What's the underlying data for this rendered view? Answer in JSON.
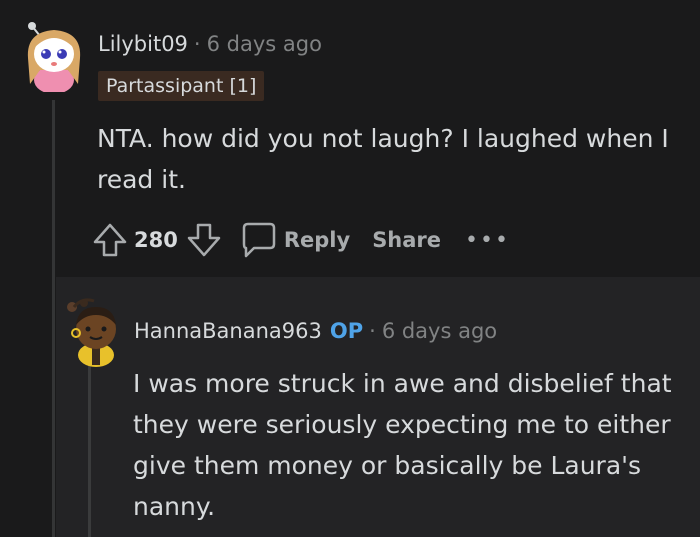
{
  "comment": {
    "username": "Lilybit09",
    "separator": "·",
    "time": "6 days ago",
    "flair": "Partassipant [1]",
    "body": "NTA. how did you not laugh? I laughed when I read it.",
    "score": "280",
    "reply_label": "Reply",
    "share_label": "Share",
    "more_label": "•••"
  },
  "reply": {
    "username": "HannaBanana963",
    "op_badge": "OP",
    "separator": "·",
    "time": "6 days ago",
    "body": "I was more struck in awe and disbelief that they were seriously expecting me to either give them money or basically be Laura's nanny."
  },
  "colors": {
    "background": "#1a1a1b",
    "reply_background": "#232325",
    "flair_background": "#3a2a21",
    "op_badge": "#4fa3e8",
    "text": "#d7dadc",
    "muted": "#818384"
  },
  "icons": {
    "upvote": "arrow-up-outline-icon",
    "downvote": "arrow-down-outline-icon",
    "reply": "speech-bubble-icon",
    "more": "ellipsis-icon"
  }
}
